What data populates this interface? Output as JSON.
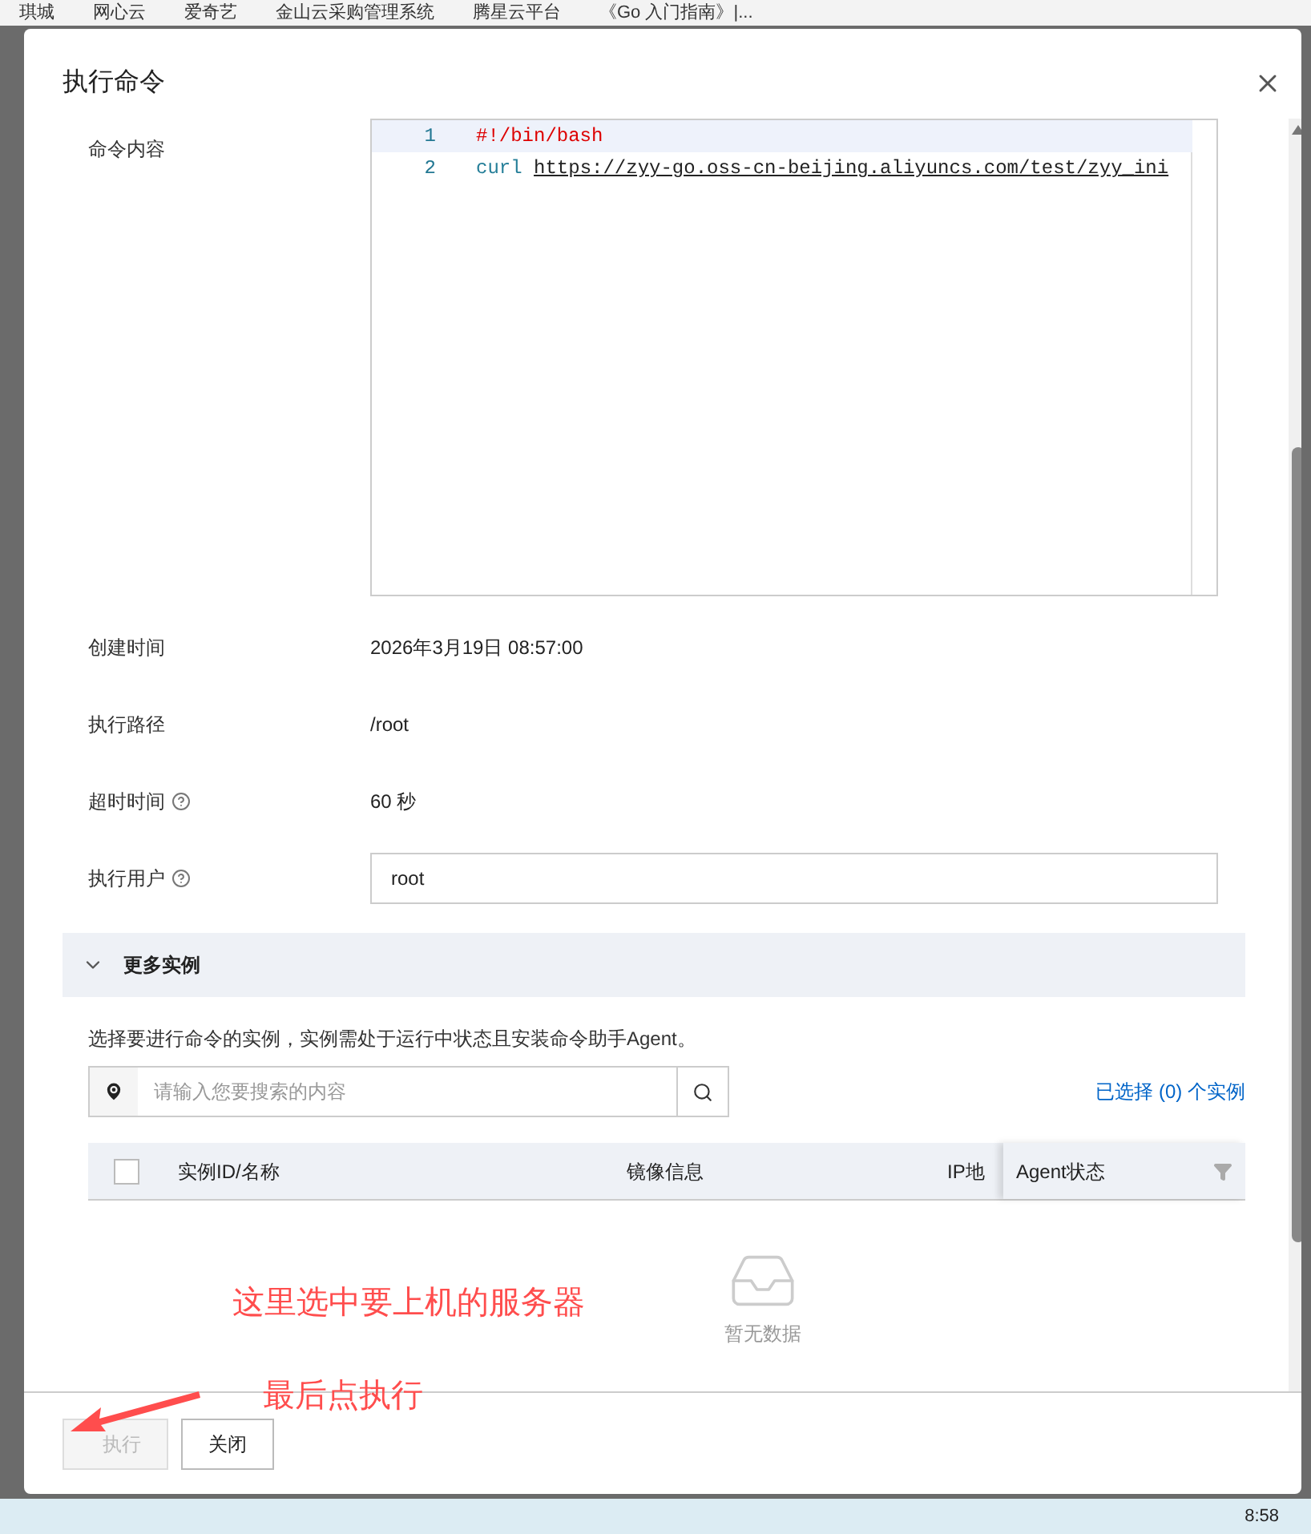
{
  "bookmarks": [
    "琪城",
    "网心云",
    "爱奇艺",
    "金山云采购管理系统",
    "腾星云平台",
    "《Go 入门指南》|..."
  ],
  "dialog": {
    "title": "执行命令",
    "command": {
      "label": "命令内容",
      "lines": [
        {
          "number": "1",
          "kind": "shebang",
          "text": "#!/bin/bash"
        },
        {
          "number": "2",
          "kind": "curl",
          "keyword": "curl",
          "text": "https://zyy-go.oss-cn-beijing.aliyuncs.com/test/zyy_ini"
        }
      ]
    },
    "fields": [
      {
        "label": "创建时间",
        "value": "2026年3月19日 08:57:00",
        "kind": "text",
        "help": false
      },
      {
        "label": "执行路径",
        "value": "/root",
        "kind": "text",
        "help": false
      },
      {
        "label": "超时时间",
        "value": "60 秒",
        "kind": "text",
        "help": true
      },
      {
        "label": "执行用户",
        "value": "root",
        "kind": "input",
        "help": true
      }
    ],
    "more": {
      "title": "更多实例",
      "expanded": true,
      "hint": "选择要进行命令的实例，实例需处于运行中状态且安装命令助手Agent。",
      "search_placeholder": "请输入您要搜索的内容",
      "selected_count": "已选择 (0) 个实例",
      "select_all_checked": false,
      "columns": [
        "实例ID/名称",
        "镜像信息",
        "IP地",
        "Agent状态"
      ],
      "empty": "暂无数据"
    },
    "buttons": [
      {
        "label": "执行",
        "disabled": true
      },
      {
        "label": "关闭",
        "disabled": false
      }
    ]
  },
  "annotations": [
    "这里选中要上机的服务器",
    "最后点执行"
  ],
  "taskbar": {
    "time": "8:58"
  }
}
